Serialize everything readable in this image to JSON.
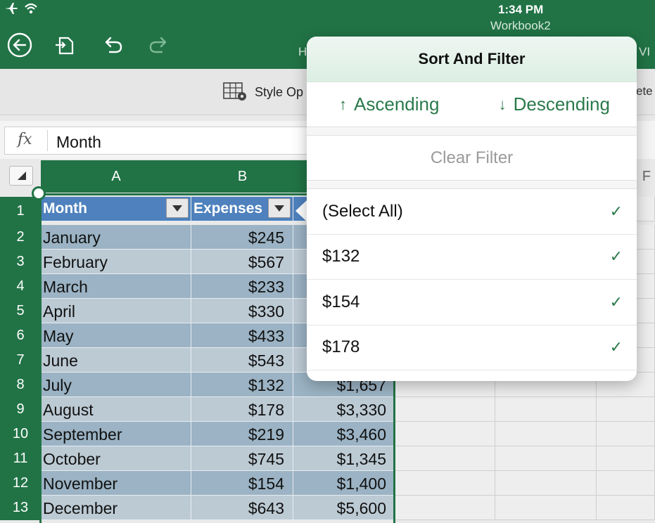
{
  "status": {
    "time": "1:34 PM",
    "workbook": "Workbook2"
  },
  "topbar": {
    "tab_fragment_left": "H",
    "tab_fragment_right": "VI"
  },
  "ribbon": {
    "style_options_label": "Style Op",
    "right_fragment": "ete"
  },
  "formula_bar": {
    "fx_label": "fx",
    "value": "Month"
  },
  "columns": {
    "a": "A",
    "b": "B",
    "f": "F"
  },
  "rows": [
    "1",
    "2",
    "3",
    "4",
    "5",
    "6",
    "7",
    "8",
    "9",
    "10",
    "11",
    "12",
    "13"
  ],
  "table": {
    "headers": {
      "month": "Month",
      "expenses": "Expenses"
    },
    "data": [
      {
        "month": "January",
        "expenses": "$245",
        "c": ""
      },
      {
        "month": "February",
        "expenses": "$567",
        "c": ""
      },
      {
        "month": "March",
        "expenses": "$233",
        "c": ""
      },
      {
        "month": "April",
        "expenses": "$330",
        "c": ""
      },
      {
        "month": "May",
        "expenses": "$433",
        "c": ""
      },
      {
        "month": "June",
        "expenses": "$543",
        "c": ""
      },
      {
        "month": "July",
        "expenses": "$132",
        "c": "$1,657"
      },
      {
        "month": "August",
        "expenses": "$178",
        "c": "$3,330"
      },
      {
        "month": "September",
        "expenses": "$219",
        "c": "$3,460"
      },
      {
        "month": "October",
        "expenses": "$745",
        "c": "$1,345"
      },
      {
        "month": "November",
        "expenses": "$154",
        "c": "$1,400"
      },
      {
        "month": "December",
        "expenses": "$643",
        "c": "$5,600"
      }
    ]
  },
  "popover": {
    "title": "Sort And Filter",
    "ascending": "Ascending",
    "descending": "Descending",
    "clear_filter": "Clear Filter",
    "options": [
      {
        "label": "(Select All)",
        "checked": true
      },
      {
        "label": "$132",
        "checked": true
      },
      {
        "label": "$154",
        "checked": true
      },
      {
        "label": "$178",
        "checked": true
      }
    ]
  },
  "colors": {
    "excel_green": "#217346",
    "header_blue": "#4e81bd",
    "accent_green": "#2b7a4b"
  }
}
